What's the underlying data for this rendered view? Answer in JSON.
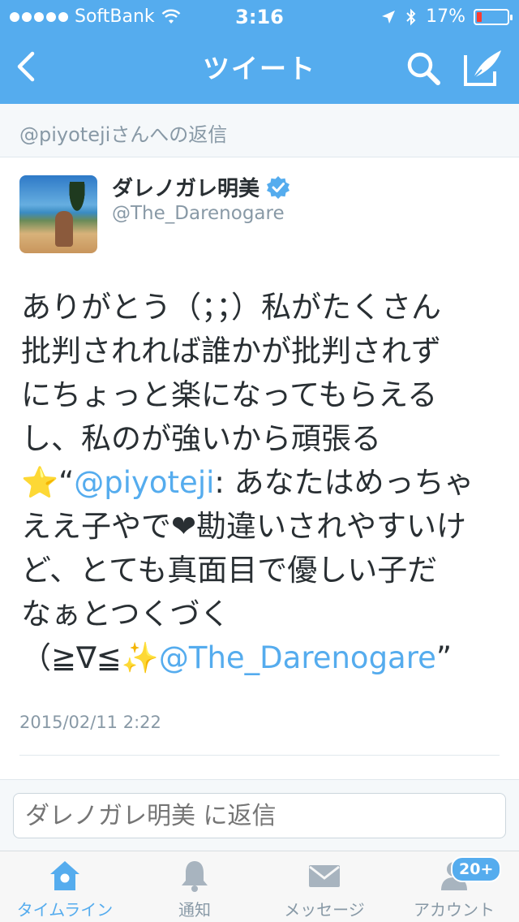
{
  "status_bar": {
    "carrier": "SoftBank",
    "time": "3:16",
    "battery_text": "17%",
    "battery_level": 0.17
  },
  "nav": {
    "title": "ツイート",
    "icons": {
      "back": "chevron-left-icon",
      "search": "search-icon",
      "compose": "compose-icon"
    }
  },
  "reply_to": "@piyotejiさんへの返信",
  "tweet": {
    "name": "ダレノガレ明美",
    "handle": "@The_Darenogare",
    "verified": true,
    "lines": {
      "l1": "ありがとう（；；）私がたくさん",
      "l2": "批判されれば誰かが批判されず",
      "l3": "にちょっと楽になってもらえる",
      "l4": "し、私のが強いから頑張る",
      "l5_star": "⭐",
      "l5_quote": "“",
      "l5_mention": "@piyoteji",
      "l5_rest": ": あなたはめっちゃ",
      "l6_a": "ええ子やで",
      "l6_heart": "❤",
      "l6_b": "勘違いされやすいけ",
      "l7": "ど、とても真面目で優しい子だ",
      "l8": "なぁとつくづく",
      "l9_a": "（≧∇≦",
      "l9_sparkle": "✨",
      "l9_mention": "@The_Darenogare",
      "l9_end": "”"
    },
    "timestamp": "2015/02/11 2:22"
  },
  "reply_box": {
    "placeholder": "ダレノガレ明美 に返信"
  },
  "tabbar": {
    "tabs": [
      {
        "label": "タイムライン",
        "icon": "home-icon",
        "active": true
      },
      {
        "label": "通知",
        "icon": "bell-icon",
        "active": false
      },
      {
        "label": "メッセージ",
        "icon": "envelope-icon",
        "active": false
      },
      {
        "label": "アカウント",
        "icon": "person-icon",
        "active": false
      }
    ],
    "account_badge": "20+"
  },
  "colors": {
    "accent": "#55acee",
    "text": "#292f33",
    "muted": "#8899a6",
    "battery_low": "#ff3b30"
  }
}
